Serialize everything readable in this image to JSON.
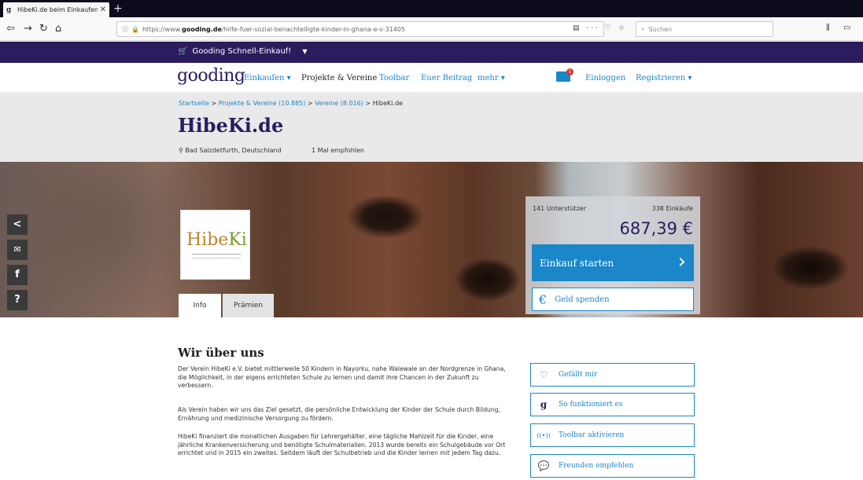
{
  "browser": {
    "tab_title": "HibeKi.de beim Einkaufen ohne",
    "tab_close": "✕",
    "new_tab": "+",
    "url_prefix": "https://www.",
    "url_domain": "gooding.de",
    "url_path": "/hilfe-fuer-sozial-benachteiligte-kinder-in-ghana-e-v-31405",
    "url_info": "ⓘ",
    "url_actions": "▤ ··· ♡ ☆",
    "search_placeholder": "Suchen",
    "library": "⫼",
    "sidebar_toggle": "▭"
  },
  "promo": {
    "label": "Gooding Schnell-Einkauf!",
    "caret": "▼"
  },
  "header": {
    "logo": "gooding",
    "menu": {
      "shop": "Einkaufen ▾",
      "projects": "Projekte & Vereine",
      "toolbar": "Toolbar",
      "contribution": "Euer Beitrag",
      "more": "mehr ▾",
      "login": "Einloggen",
      "register": "Registrieren ▾"
    },
    "mail_badge": "1"
  },
  "breadcrumb": {
    "home": "Startseite",
    "sep1": " > ",
    "projects": "Projekte & Vereine (10.885)",
    "sep2": " > ",
    "clubs": "Vereine (8.016)",
    "sep3": " > ",
    "current": "HibeKi.de"
  },
  "page": {
    "title": "HibeKi.de",
    "location": "Bad Salzdetfurth, Deutschland",
    "recommended": "1 Mal empfohlen"
  },
  "social": [
    "<",
    "✉",
    "f",
    "?"
  ],
  "org_logo": {
    "text_main": "Hibe",
    "text_k": "Ki"
  },
  "tabs": {
    "info": "Info",
    "rewards": "Prämien"
  },
  "support": {
    "supporters": "141 Unterstützer",
    "purchases": "338 Einkäufe",
    "amount": "687,39 €",
    "start_label": "Einkauf starten",
    "start_chevron": "›",
    "donate_icon": "€",
    "donate_label": "Geld spenden"
  },
  "about": {
    "title": "Wir über uns",
    "p1": "Der Verein HibeKi e.V. bietet mittlerweile 50 Kindern in Nayorku, nahe Walewale an der Nordgrenze in Ghana, die Möglichkeit, in der eigens errichteten Schule zu lernen und damit ihre Chancen in der Zukunft zu verbessern.",
    "p2": "Als Verein haben wir uns das Ziel gesetzt, die persönliche Entwicklung der Kinder der Schule durch Bildung, Ernährung und medizinische Versorgung zu fördern.",
    "p3": "HibeKi finanziert die monatlichen Ausgaben für Lehrergehälter, eine tägliche Mahlzeit für die Kinder, eine jährliche Krankenversicherung und benötigte Schulmaterialien. 2013 wurde bereits ein Schulgebäude vor Ort errichtet und in 2015 ein zweites. Seitdem läuft der Schulbetrieb und die Kinder lernen mit jedem Tag dazu."
  },
  "actions": {
    "like_icon": "♡",
    "like": "Gefällt mir",
    "how_icon": "g",
    "how": "So funktioniert es",
    "toolbar_icon": "((•))",
    "toolbar": "Toolbar aktivieren",
    "share_icon": "💬",
    "share": "Freunden empfehlen"
  },
  "colors": {
    "brand": "#2b1c5e",
    "accent": "#1b87c9"
  }
}
